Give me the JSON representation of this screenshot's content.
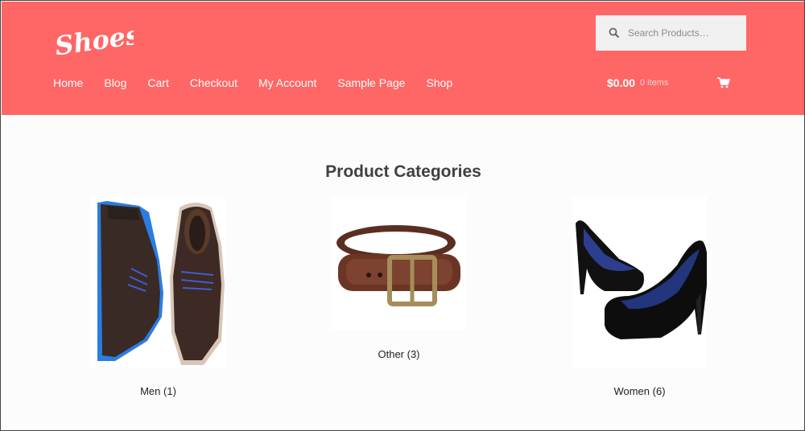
{
  "header": {
    "background": "#ff6666",
    "logo_text": "Shoes!",
    "nav": [
      "Home",
      "Blog",
      "Cart",
      "Checkout",
      "My Account",
      "Sample Page",
      "Shop"
    ],
    "search_placeholder": "Search Products…",
    "search_icon": "search-icon",
    "cart_amount": "$0.00",
    "cart_count": "0 items",
    "cart_icon": "shopping-cart-icon"
  },
  "main": {
    "title": "Product Categories",
    "categories": [
      {
        "name": "Men",
        "count": "(1)"
      },
      {
        "name": "Other",
        "count": "(3)"
      },
      {
        "name": "Women",
        "count": "(6)"
      }
    ]
  }
}
